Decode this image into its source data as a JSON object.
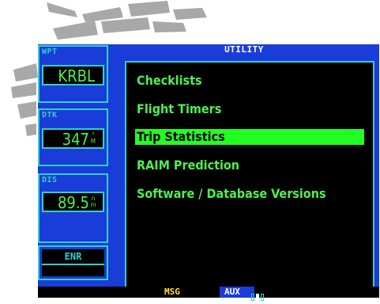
{
  "sidebar": {
    "wpt": {
      "label": "WPT",
      "value": "KRBL"
    },
    "dtk": {
      "label": "DTK",
      "value": "347",
      "unit_top": "°",
      "unit_bottom": "M"
    },
    "dis": {
      "label": "DIS",
      "value": "89.5",
      "unit_top": "n",
      "unit_bottom": "m"
    },
    "mode": "ENR"
  },
  "page_title": "UTILITY",
  "menu": {
    "items": [
      {
        "label": "Checklists"
      },
      {
        "label": "Flight Timers"
      },
      {
        "label": "Trip Statistics"
      },
      {
        "label": "RAIM Prediction"
      },
      {
        "label": "Software / Database Versions"
      }
    ],
    "selected_index": 2
  },
  "status_bar": {
    "msg": "MSG",
    "page_group": "AUX"
  },
  "colors": {
    "screen_blue": "#1a3cd8",
    "text_green": "#4ef04e",
    "highlight_green": "#22ff22",
    "border_cyan": "#2fd0d0",
    "msg_yellow": "#ffe040"
  }
}
